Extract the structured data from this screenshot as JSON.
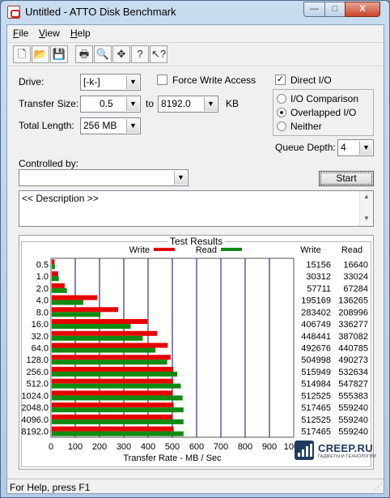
{
  "window": {
    "title": "Untitled - ATTO Disk Benchmark",
    "min_label": "—",
    "max_label": "□",
    "close_label": "X"
  },
  "menu": [
    {
      "underline": "F",
      "rest": "ile"
    },
    {
      "underline": "V",
      "rest": "iew"
    },
    {
      "underline": "H",
      "rest": "elp"
    }
  ],
  "toolbar": [
    {
      "name": "new-icon",
      "glyph": "🗋"
    },
    {
      "name": "open-icon",
      "glyph": "📂"
    },
    {
      "name": "save-icon",
      "glyph": "💾"
    },
    {
      "name": "print-icon",
      "glyph": "🖶"
    },
    {
      "name": "print-preview-icon",
      "glyph": "🔍"
    },
    {
      "name": "move-icon",
      "glyph": "✥"
    },
    {
      "name": "help-icon",
      "glyph": "?"
    },
    {
      "name": "context-help-icon",
      "glyph": "↖?"
    }
  ],
  "form": {
    "drive_label": "Drive:",
    "drive_value": "[-k-]",
    "force_write_label": "Force Write Access",
    "force_write_checked": false,
    "direct_io_label": "Direct I/O",
    "direct_io_checked": true,
    "transfer_size_label": "Transfer Size:",
    "transfer_from": "0.5",
    "transfer_to_label": "to",
    "transfer_to": "8192.0",
    "transfer_unit": "KB",
    "total_length_label": "Total Length:",
    "total_length_value": "256 MB",
    "io_options": [
      "I/O Comparison",
      "Overlapped I/O",
      "Neither"
    ],
    "io_selected": 1,
    "queue_depth_label": "Queue Depth:",
    "queue_depth_value": "4",
    "controlled_by_label": "Controlled by:",
    "controlled_by_value": "",
    "start_label": "Start",
    "description_text": "<< Description >>"
  },
  "results_title": "Test Results",
  "colors": {
    "write": "#e60000",
    "read": "#118a11",
    "grid": "#0a0a7a"
  },
  "chart_data": {
    "type": "bar",
    "orientation": "horizontal",
    "title": "Test Results",
    "xlabel": "Transfer Rate - MB / Sec",
    "xlim": [
      0,
      1000
    ],
    "x_ticks": [
      "0",
      "100",
      "200",
      "300",
      "400",
      "500",
      "600",
      "700",
      "800",
      "900",
      "1000"
    ],
    "categories": [
      "0.5",
      "1.0",
      "2.0",
      "4.0",
      "8.0",
      "16.0",
      "32.0",
      "64.0",
      "128.0",
      "256.0",
      "512.0",
      "1024.0",
      "2048.0",
      "4096.0",
      "8192.0"
    ],
    "series": [
      {
        "name": "Write",
        "values_kb": [
          15156,
          30312,
          57711,
          195169,
          283402,
          406749,
          448441,
          492676,
          504998,
          515949,
          514984,
          512525,
          517465,
          512525,
          517465
        ]
      },
      {
        "name": "Read",
        "values_kb": [
          16640,
          33024,
          67284,
          136265,
          208996,
          336277,
          387082,
          440785,
          490273,
          532634,
          547827,
          555383,
          559240,
          559240,
          559240
        ]
      }
    ],
    "table_headers": [
      "Write",
      "Read"
    ],
    "grid": true,
    "legend": "top"
  },
  "logo": {
    "name": "CREEP.RU",
    "tagline": "ГАДЖЕТЫ И ТЕХНОЛОГИИ"
  },
  "status": "For Help, press F1"
}
